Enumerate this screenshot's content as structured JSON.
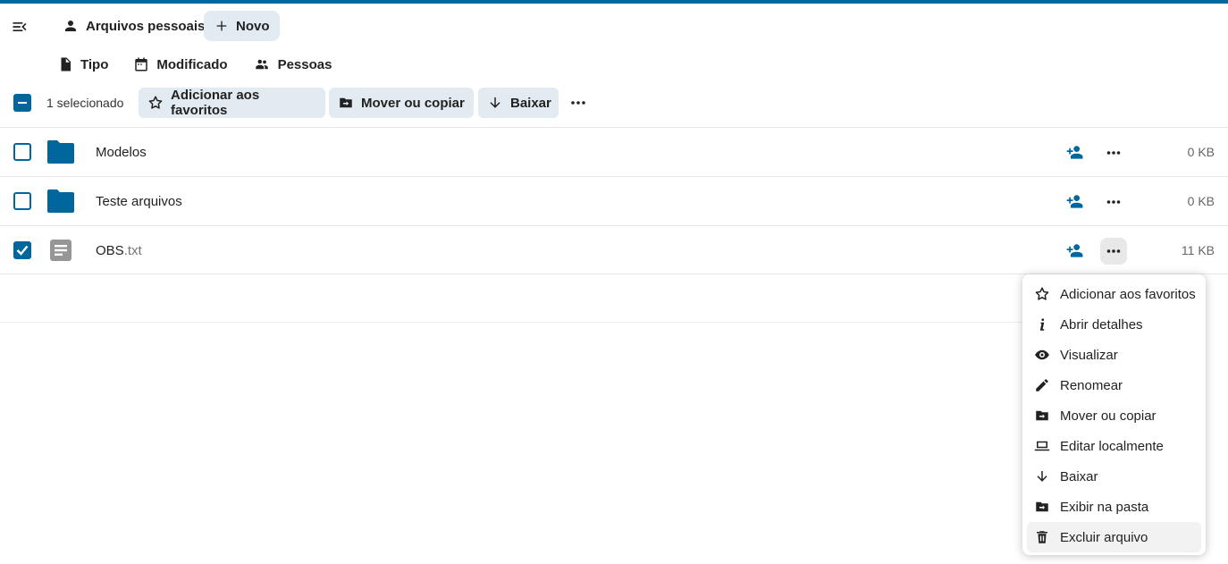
{
  "header": {
    "breadcrumb_label": "Arquivos pessoais",
    "new_button_label": "Novo"
  },
  "filters": {
    "type_label": "Tipo",
    "modified_label": "Modificado",
    "people_label": "Pessoas"
  },
  "selection_bar": {
    "selected_text": "1 selecionado",
    "favorite_label": "Adicionar aos favoritos",
    "move_copy_label": "Mover ou copiar",
    "download_label": "Baixar"
  },
  "files": [
    {
      "name": "Modelos",
      "ext": "",
      "size": "0 KB",
      "type": "folder",
      "checked": false
    },
    {
      "name": "Teste arquivos",
      "ext": "",
      "size": "0 KB",
      "type": "folder",
      "checked": false
    },
    {
      "name": "OBS",
      "ext": ".txt",
      "size": "11 KB",
      "type": "text",
      "checked": true
    }
  ],
  "context_menu": {
    "items": [
      {
        "label": "Adicionar aos favoritos",
        "icon": "star-outline-icon"
      },
      {
        "label": "Abrir detalhes",
        "icon": "info-icon"
      },
      {
        "label": "Visualizar",
        "icon": "eye-icon"
      },
      {
        "label": "Renomear",
        "icon": "pencil-icon"
      },
      {
        "label": "Mover ou copiar",
        "icon": "folder-move-icon"
      },
      {
        "label": "Editar localmente",
        "icon": "laptop-icon"
      },
      {
        "label": "Baixar",
        "icon": "arrow-down-icon"
      },
      {
        "label": "Exibir na pasta",
        "icon": "folder-move-icon"
      },
      {
        "label": "Excluir arquivo",
        "icon": "trash-icon"
      }
    ]
  },
  "colors": {
    "primary": "#00679e",
    "button_bg": "#e3ebf2",
    "text_icon": "#969696"
  }
}
